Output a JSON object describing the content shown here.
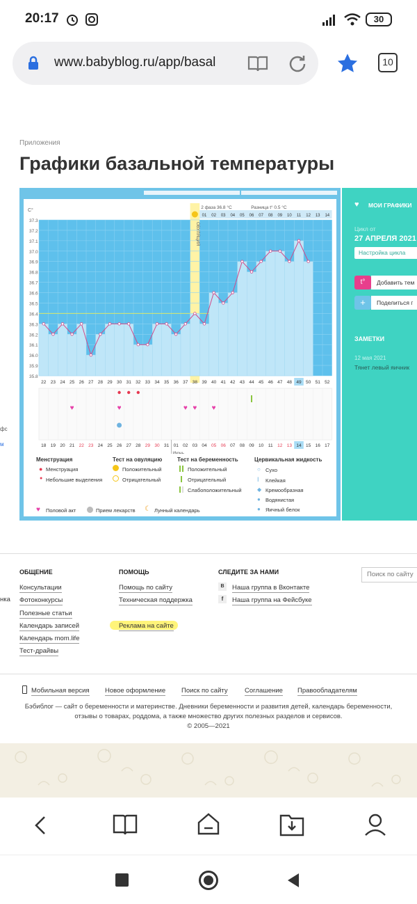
{
  "status_bar": {
    "time": "20:17",
    "battery": "30"
  },
  "browser": {
    "url": "www.babyblog.ru/app/basal",
    "tab_count": "10"
  },
  "page": {
    "breadcrumb": "Приложения",
    "title": "Графики базальной температуры"
  },
  "chart_data": {
    "type": "line",
    "ylabel": "C°",
    "ylim": [
      35.8,
      37.3
    ],
    "yticks": [
      "37.3",
      "37.2",
      "37.1",
      "37.0",
      "36.9",
      "36.8",
      "36.7",
      "36.6",
      "36.5",
      "36.4",
      "36.3",
      "36.2",
      "36.1",
      "36.0",
      "35.9",
      "35.8"
    ],
    "phase2_label": "2 фаза",
    "phase2_value": "36.8 °C",
    "diff_label": "Разница t°",
    "diff_value": "0.5 °C",
    "ovulation_label": "ОВУЛЯЦИЯ",
    "top_days": [
      "01",
      "02",
      "03",
      "04",
      "05",
      "06",
      "07",
      "08",
      "09",
      "10",
      "11",
      "12",
      "13",
      "14"
    ],
    "cycle_days": [
      "22",
      "23",
      "24",
      "25",
      "26",
      "27",
      "28",
      "29",
      "30",
      "31",
      "32",
      "33",
      "34",
      "35",
      "36",
      "37",
      "38",
      "39",
      "40",
      "41",
      "42",
      "43",
      "44",
      "45",
      "46",
      "47",
      "48",
      "49",
      "50",
      "51",
      "52"
    ],
    "dates": [
      "18",
      "19",
      "20",
      "21",
      "22",
      "23",
      "24",
      "25",
      "26",
      "27",
      "28",
      "29",
      "30",
      "31",
      "01",
      "02",
      "03",
      "04",
      "05",
      "06",
      "07",
      "08",
      "09",
      "10",
      "11",
      "12",
      "13",
      "14",
      "15",
      "16",
      "17"
    ],
    "month_label": "Июнь",
    "series": [
      {
        "values": [
          36.3,
          36.2,
          36.3,
          36.2,
          36.3,
          36.0,
          36.2,
          36.3,
          36.3,
          36.3,
          36.1,
          36.1,
          36.3,
          36.3,
          36.2,
          36.3,
          36.4,
          36.3,
          36.6,
          36.5,
          36.6,
          36.9,
          36.8,
          36.9,
          37.0,
          37.0,
          36.9,
          37.1,
          36.9
        ]
      }
    ]
  },
  "legend": {
    "menstruation": {
      "title": "Менструация",
      "items": [
        "Менструация",
        "Небольшие выделения"
      ]
    },
    "ovulation_test": {
      "title": "Тест на овуляцию",
      "items": [
        "Положительный",
        "Отрицательный"
      ]
    },
    "pregnancy_test": {
      "title": "Тест на беременность",
      "items": [
        "Положительный",
        "Отрицательный",
        "Слабоположительный"
      ]
    },
    "cervical": {
      "title": "Цервикальная жидкость",
      "items": [
        "Сухо",
        "Клейкая",
        "Кремообразная",
        "Водянистая",
        "Яичный белок"
      ]
    },
    "bottom": [
      "Половой акт",
      "Прием лекарств",
      "Лунный календарь"
    ]
  },
  "side": {
    "my_charts": "МОИ ГРАФИКИ",
    "cycle_from": "Цикл от",
    "cycle_date": "27 АПРЕЛЯ 2021",
    "cycle_settings": "Настройка цикла",
    "add_temp": "Добавить тем",
    "share": "Поделиться г",
    "notes_title": "ЗАМЕТКИ",
    "note_date": "12 мая 2021",
    "note_text": "Тянет левый яичник"
  },
  "footer": {
    "col1_title": "ОБЩЕНИЕ",
    "col1": [
      "Консультации",
      "Фотоконкурсы",
      "Полезные статьи",
      "Календарь записей",
      "Календарь mom.life",
      "Тест-драйвы"
    ],
    "col2_title": "ПОМОЩЬ",
    "col2": [
      "Помощь по сайту",
      "Техническая поддержка",
      "Реклама на сайте"
    ],
    "col3_title": "СЛЕДИТЕ ЗА НАМИ",
    "col3": [
      "Наша группа в Вконтакте",
      "Наша группа на Фейсбуке"
    ],
    "search_placeholder": "Поиск по сайту",
    "bottom_links": [
      "Мобильная версия",
      "Новое оформление",
      "Поиск по сайту",
      "Соглашение",
      "Правообладателям"
    ],
    "about_line1": "Бэбиблог — сайт о беременности и материнстве. Дневники беременности и развития детей, календарь беременности,",
    "about_line2": "отзывы о товарах, роддома, а также множество других полезных разделов и сервисов.",
    "copyright": "© 2005—2021",
    "left_cut1": "нка",
    "left_cut2": "фс",
    "left_cut3": "м"
  }
}
